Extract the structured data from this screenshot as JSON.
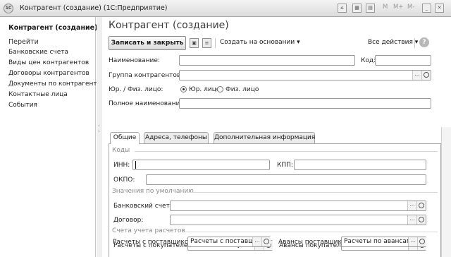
{
  "window": {
    "title": "Контрагент (создание)  (1С:Предприятие)",
    "memory_buttons": [
      "M",
      "M+",
      "M-"
    ]
  },
  "sidebar": {
    "title": "Контрагент (создание)",
    "goto_label": "Перейти",
    "items": [
      {
        "label": "Банковские счета"
      },
      {
        "label": "Виды цен контрагентов"
      },
      {
        "label": "Договоры контрагентов"
      },
      {
        "label": "Документы по контрагенту"
      },
      {
        "label": "Контактные лица"
      },
      {
        "label": "События"
      }
    ]
  },
  "main": {
    "title": "Контрагент (создание)",
    "toolbar": {
      "save_close_label": "Записать и закрыть",
      "create_based_label": "Создать на основании",
      "all_actions_label": "Все действия",
      "help_label": "?"
    },
    "fields": {
      "name_label": "Наименование:",
      "name_value": "",
      "code_label": "Код:",
      "code_value": "",
      "group_label": "Группа контрагентов:",
      "group_value": "",
      "legal_type_label": "Юр. / Физ. лицо:",
      "legal_option": "Юр. лицо",
      "physical_option": "Физ. лицо",
      "selected_option": "legal",
      "full_name_label": "Полное наименование:",
      "full_name_value": ""
    },
    "tabs": [
      {
        "label": "Общие",
        "active": true
      },
      {
        "label": "Адреса, телефоны",
        "active": false
      },
      {
        "label": "Дополнительная информация",
        "active": false
      }
    ],
    "general": {
      "codes_group": "Коды",
      "inn_label": "ИНН:",
      "inn_value": "",
      "kpp_label": "КПП:",
      "kpp_value": "",
      "okpo_label": "ОКПО:",
      "okpo_value": "",
      "defaults_group": "Значения по умолчанию",
      "bank_account_label": "Банковский счет:",
      "bank_account_value": "",
      "contract_label": "Договор:",
      "contract_value": "",
      "accounts_group": "Счета учета расчетов",
      "buyers_label": "Расчеты с покупателем:",
      "buyers_value": "Расчеты с покупателя",
      "buyer_advances_label": "Авансы покупателя:",
      "buyer_advances_value": "Расчеты по авансам п",
      "suppliers_label": "Расчеты с поставщиком:",
      "suppliers_value": "Расчеты с поставщи",
      "supplier_advances_label": "Авансы поставщику:",
      "supplier_advances_value": "Расчеты по авансам п"
    }
  }
}
